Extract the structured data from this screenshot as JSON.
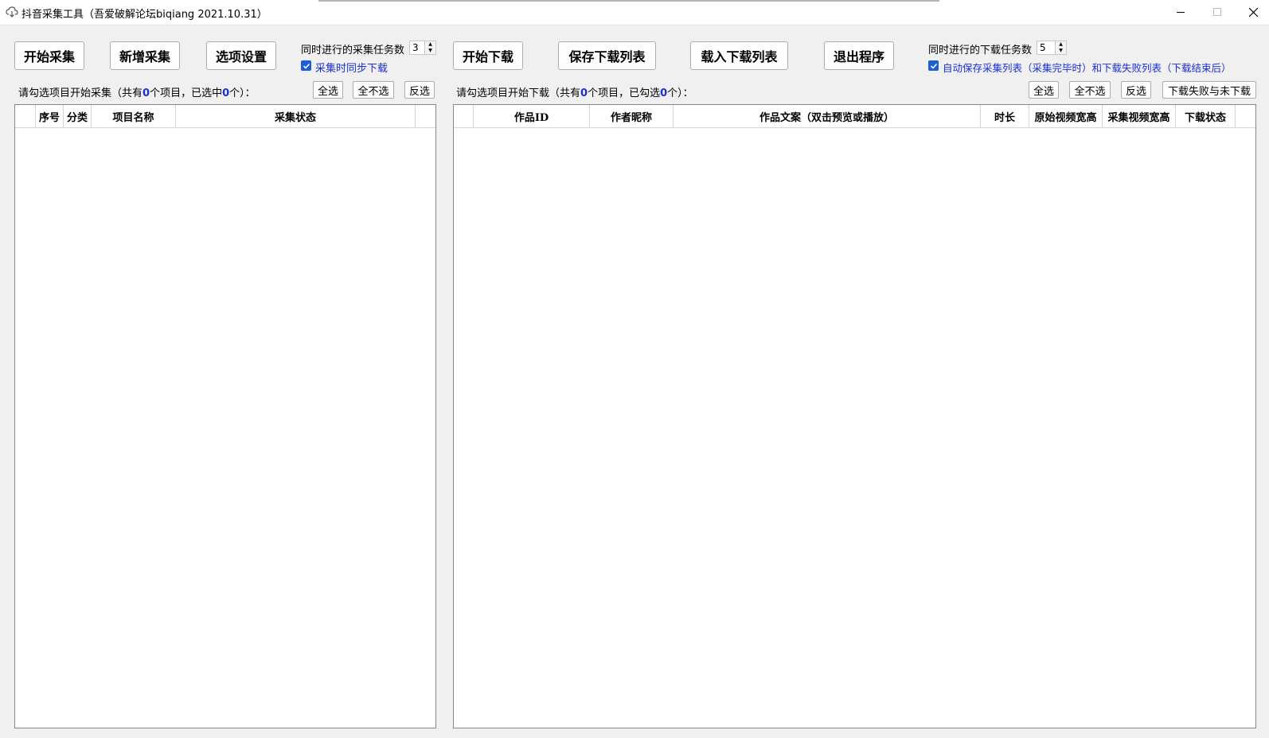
{
  "window": {
    "title": "抖音采集工具（吾爱破解论坛biqiang 2021.10.31）"
  },
  "toolbar": {
    "start_collect": "开始采集",
    "add_collect": "新增采集",
    "options": "选项设置",
    "collect_tasks_label": "同时进行的采集任务数",
    "collect_tasks_value": "3",
    "sync_download_label": "采集时同步下载",
    "sync_download_checked": true,
    "start_download": "开始下载",
    "save_list": "保存下载列表",
    "load_list": "载入下载列表",
    "exit": "退出程序",
    "download_tasks_label": "同时进行的下载任务数",
    "download_tasks_value": "5",
    "auto_save_label": "自动保存采集列表（采集完毕时）和下载失败列表（下载结束后）",
    "auto_save_checked": true
  },
  "left_panel": {
    "status_prefix": "请勾选项目开始采集（共有",
    "total": "0",
    "status_mid": "个项目，已选中",
    "selected": "0",
    "status_suffix": "个）：",
    "select_all": "全选",
    "select_none": "全不选",
    "invert": "反选",
    "columns": [
      "",
      "序号",
      "分类",
      "项目名称",
      "采集状态",
      ""
    ]
  },
  "right_panel": {
    "status_prefix": "请勾选项目开始下载（共有",
    "total": "0",
    "status_mid": "个项目，已勾选",
    "selected": "0",
    "status_suffix": "个）：",
    "select_all": "全选",
    "select_none": "全不选",
    "invert": "反选",
    "failed_undownloaded": "下载失败与未下载",
    "columns": [
      "",
      "作品ID",
      "作者昵称",
      "作品文案（双击预览或播放）",
      "时长",
      "原始视频宽高",
      "采集视频宽高",
      "下载状态",
      ""
    ]
  },
  "colors": {
    "accent": "#1a5fd6",
    "count_blue": "#1a2fd6",
    "background": "#f0f0f0"
  }
}
